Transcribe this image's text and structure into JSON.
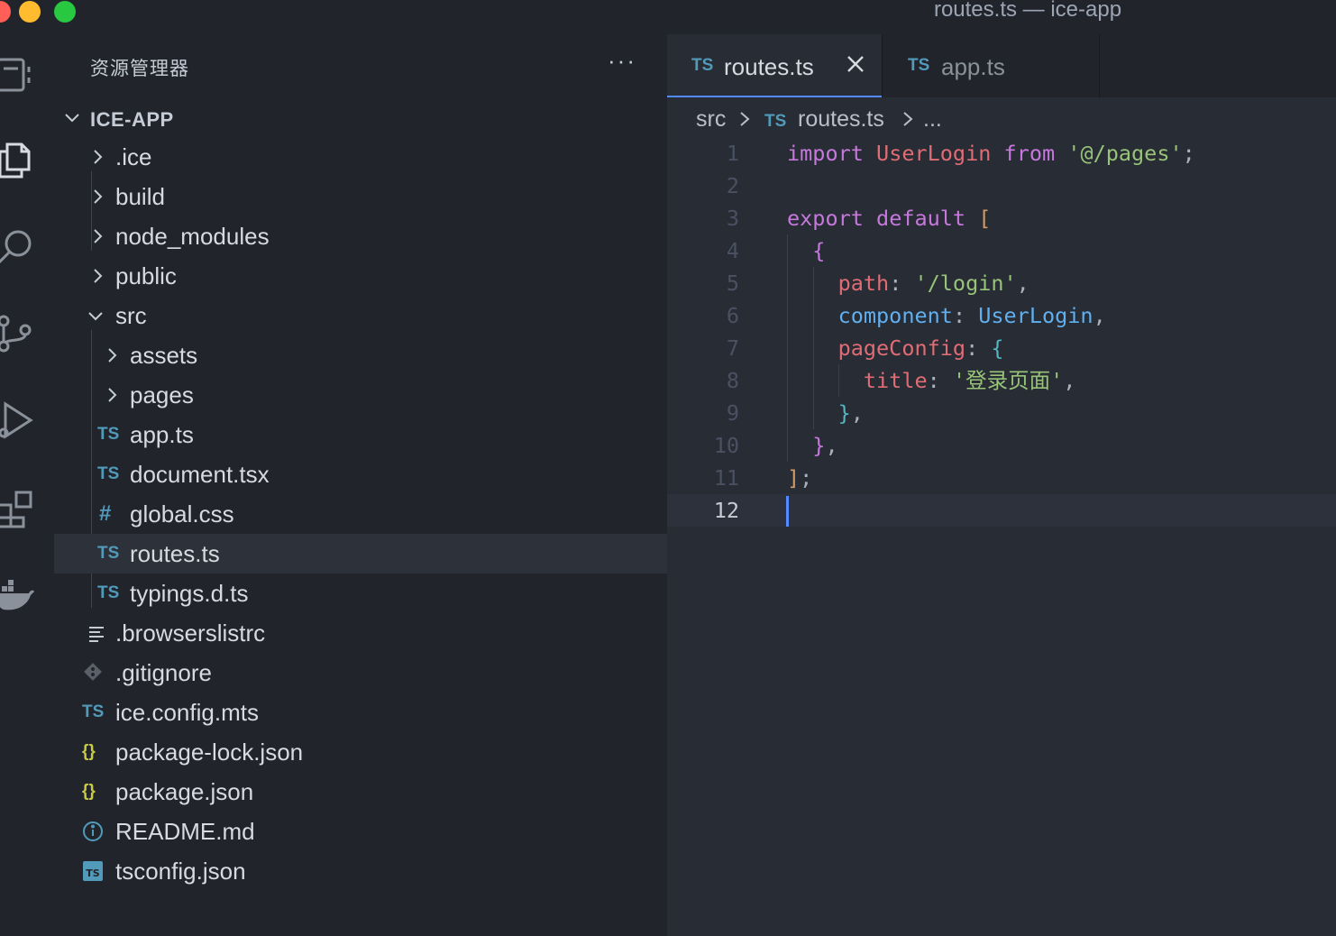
{
  "window": {
    "title": "routes.ts — ice-app",
    "traffic_lights": {
      "close": "#ff5f57",
      "minimize": "#febc2e",
      "zoom": "#28c840"
    }
  },
  "activity_bar": [
    {
      "name": "explorer-icon"
    },
    {
      "name": "files-icon",
      "active": true
    },
    {
      "name": "search-icon"
    },
    {
      "name": "source-control-icon"
    },
    {
      "name": "run-debug-icon"
    },
    {
      "name": "extensions-icon"
    },
    {
      "name": "docker-icon"
    }
  ],
  "sidebar": {
    "title": "资源管理器",
    "more": "···",
    "root": {
      "label": "ICE-APP",
      "expanded": true
    },
    "tree": [
      {
        "label": ".ice",
        "type": "folder",
        "depth": 1,
        "expanded": false
      },
      {
        "label": "build",
        "type": "folder",
        "depth": 1,
        "expanded": false
      },
      {
        "label": "node_modules",
        "type": "folder",
        "depth": 1,
        "expanded": false
      },
      {
        "label": "public",
        "type": "folder",
        "depth": 1,
        "expanded": false
      },
      {
        "label": "src",
        "type": "folder",
        "depth": 1,
        "expanded": true
      },
      {
        "label": "assets",
        "type": "folder",
        "depth": 2,
        "expanded": false
      },
      {
        "label": "pages",
        "type": "folder",
        "depth": 2,
        "expanded": false
      },
      {
        "label": "app.ts",
        "type": "file",
        "icon": "TS",
        "depth": 2
      },
      {
        "label": "document.tsx",
        "type": "file",
        "icon": "TS",
        "depth": 2
      },
      {
        "label": "global.css",
        "type": "file",
        "icon": "#",
        "depth": 2
      },
      {
        "label": "routes.ts",
        "type": "file",
        "icon": "TS",
        "depth": 2,
        "selected": true
      },
      {
        "label": "typings.d.ts",
        "type": "file",
        "icon": "TS",
        "depth": 2
      },
      {
        "label": ".browserslistrc",
        "type": "file",
        "icon": "lines",
        "depth": 1
      },
      {
        "label": ".gitignore",
        "type": "file",
        "icon": "git",
        "depth": 1
      },
      {
        "label": "ice.config.mts",
        "type": "file",
        "icon": "TS",
        "depth": 1
      },
      {
        "label": "package-lock.json",
        "type": "file",
        "icon": "{}",
        "depth": 1
      },
      {
        "label": "package.json",
        "type": "file",
        "icon": "{}",
        "depth": 1
      },
      {
        "label": "README.md",
        "type": "file",
        "icon": "info",
        "depth": 1
      },
      {
        "label": "tsconfig.json",
        "type": "file",
        "icon": "tsconfig",
        "depth": 1
      }
    ]
  },
  "editor": {
    "tabs": [
      {
        "icon": "TS",
        "label": "routes.ts",
        "active": true,
        "close": true
      },
      {
        "icon": "TS",
        "label": "app.ts",
        "active": false
      }
    ],
    "breadcrumb": {
      "folder": "src",
      "file_icon": "TS",
      "file": "routes.ts",
      "more": "..."
    },
    "current_line": 12,
    "code": [
      {
        "n": "1",
        "tokens": [
          [
            "kw",
            "import"
          ],
          [
            "pun",
            " "
          ],
          [
            "id",
            "UserLogin"
          ],
          [
            "pun",
            " "
          ],
          [
            "kw",
            "from"
          ],
          [
            "pun",
            " "
          ],
          [
            "str",
            "'@/pages'"
          ],
          [
            "pun",
            ";"
          ]
        ]
      },
      {
        "n": "2",
        "tokens": []
      },
      {
        "n": "3",
        "tokens": [
          [
            "kw",
            "export"
          ],
          [
            "pun",
            " "
          ],
          [
            "kw",
            "default"
          ],
          [
            "pun",
            " "
          ],
          [
            "br1",
            "["
          ]
        ]
      },
      {
        "n": "4",
        "tokens": [
          [
            "pun",
            "  "
          ],
          [
            "br2",
            "{"
          ]
        ]
      },
      {
        "n": "5",
        "tokens": [
          [
            "pun",
            "    "
          ],
          [
            "id",
            "path"
          ],
          [
            "pun",
            ": "
          ],
          [
            "str",
            "'/login'"
          ],
          [
            "pun",
            ","
          ]
        ]
      },
      {
        "n": "6",
        "tokens": [
          [
            "pun",
            "    "
          ],
          [
            "fn",
            "component"
          ],
          [
            "pun",
            ": "
          ],
          [
            "fn",
            "UserLogin"
          ],
          [
            "pun",
            ","
          ]
        ]
      },
      {
        "n": "7",
        "tokens": [
          [
            "pun",
            "    "
          ],
          [
            "id",
            "pageConfig"
          ],
          [
            "pun",
            ": "
          ],
          [
            "br3",
            "{"
          ]
        ]
      },
      {
        "n": "8",
        "tokens": [
          [
            "pun",
            "      "
          ],
          [
            "id",
            "title"
          ],
          [
            "pun",
            ": "
          ],
          [
            "str",
            "'登录页面'"
          ],
          [
            "pun",
            ","
          ]
        ]
      },
      {
        "n": "9",
        "tokens": [
          [
            "pun",
            "    "
          ],
          [
            "br3",
            "}"
          ],
          [
            "pun",
            ","
          ]
        ]
      },
      {
        "n": "10",
        "tokens": [
          [
            "pun",
            "  "
          ],
          [
            "br2",
            "}"
          ],
          [
            "pun",
            ","
          ]
        ]
      },
      {
        "n": "11",
        "tokens": [
          [
            "br1",
            "]"
          ],
          [
            "pun",
            ";"
          ]
        ]
      },
      {
        "n": "12",
        "tokens": []
      }
    ]
  },
  "colors": {
    "ts_icon": "#519aba",
    "css_icon": "#519aba",
    "json_icon": "#cbcb41",
    "accent": "#528bff",
    "selection": "#2c313a"
  }
}
